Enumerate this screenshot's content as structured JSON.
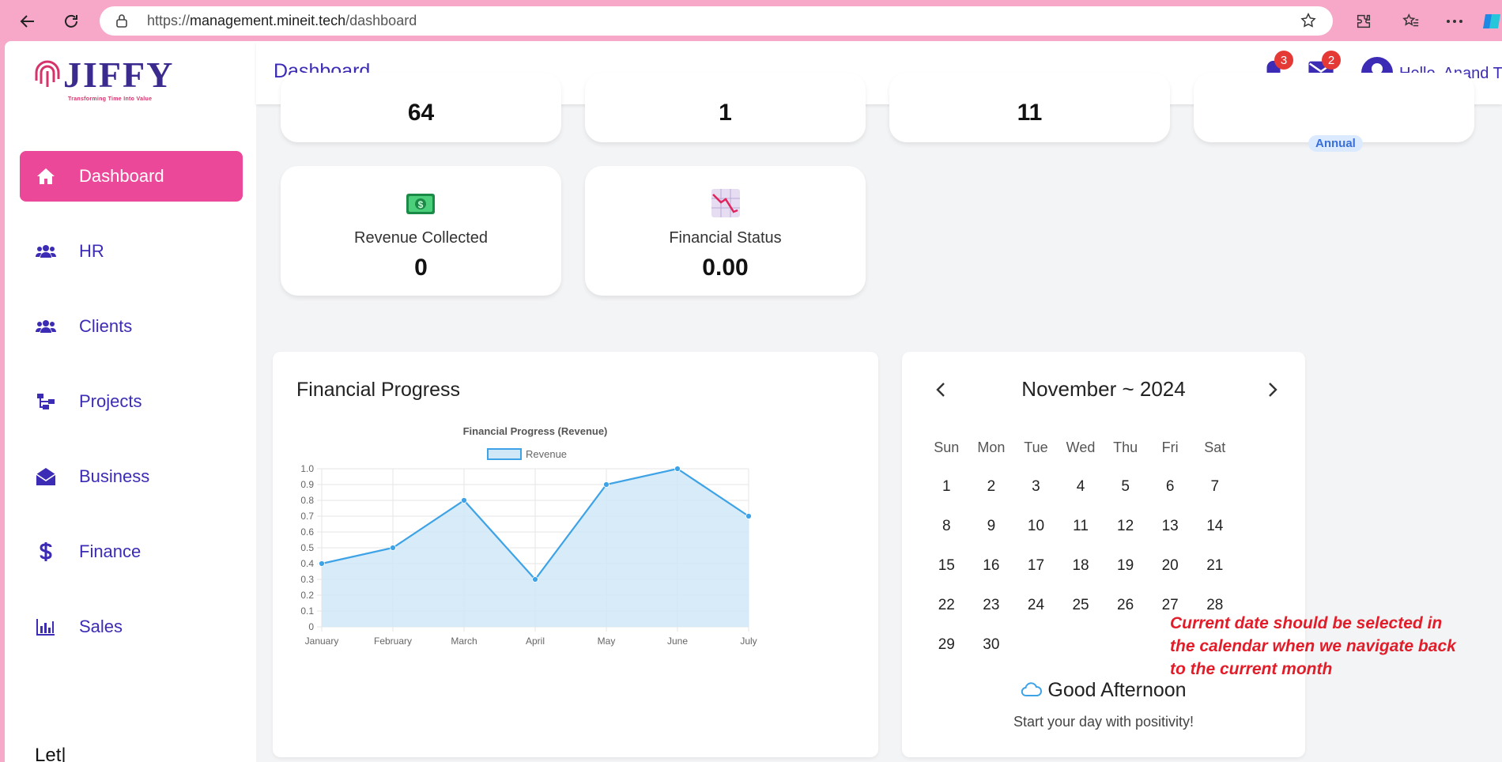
{
  "browser": {
    "url_prefix": "https://",
    "url_host": "management.mineit.tech",
    "url_path": "/dashboard"
  },
  "sidebar": {
    "logo_text": "JIFFY",
    "logo_tagline": "Transforming Time Into Value",
    "items": [
      {
        "label": "Dashboard",
        "icon": "home-icon",
        "active": true
      },
      {
        "label": "HR",
        "icon": "users-icon"
      },
      {
        "label": "Clients",
        "icon": "users-icon"
      },
      {
        "label": "Projects",
        "icon": "sitemap-icon"
      },
      {
        "label": "Business",
        "icon": "envelope-open-icon"
      },
      {
        "label": "Finance",
        "icon": "dollar-icon"
      },
      {
        "label": "Sales",
        "icon": "bar-chart-icon"
      }
    ],
    "footer_text": "Let|"
  },
  "header": {
    "title": "Dashboard",
    "notifications_count": "3",
    "messages_count": "2",
    "greeting": "Hello, Anand T"
  },
  "stats_top": [
    {
      "value": "64"
    },
    {
      "value": "1"
    },
    {
      "value": "11"
    },
    {
      "badge": "Annual"
    }
  ],
  "stats": [
    {
      "label": "Revenue Collected",
      "value": "0",
      "icon": "money-icon"
    },
    {
      "label": "Financial Status",
      "value": "0.00",
      "icon": "chart-decreasing-icon"
    }
  ],
  "financial_panel": {
    "title": "Financial Progress"
  },
  "chart_data": {
    "type": "area",
    "title": "Financial Progress (Revenue)",
    "categories": [
      "January",
      "February",
      "March",
      "April",
      "May",
      "June",
      "July"
    ],
    "series": [
      {
        "name": "Revenue",
        "values": [
          0.4,
          0.5,
          0.8,
          0.3,
          0.9,
          1.0,
          0.7
        ]
      }
    ],
    "yticks": [
      "0",
      "0.1",
      "0.2",
      "0.3",
      "0.4",
      "0.5",
      "0.6",
      "0.7",
      "0.8",
      "0.9",
      "1.0"
    ],
    "ylim": [
      0,
      1.0
    ],
    "grid": true,
    "legend": "top",
    "colors": {
      "line": "#3ea3e6",
      "fill": "#d0e7f7"
    }
  },
  "calendar": {
    "month_label": "November ~ 2024",
    "days_of_week": [
      "Sun",
      "Mon",
      "Tue",
      "Wed",
      "Thu",
      "Fri",
      "Sat"
    ],
    "weeks": [
      [
        "1",
        "2",
        "3",
        "4",
        "5",
        "6",
        "7"
      ],
      [
        "8",
        "9",
        "10",
        "11",
        "12",
        "13",
        "14"
      ],
      [
        "15",
        "16",
        "17",
        "18",
        "19",
        "20",
        "21"
      ],
      [
        "22",
        "23",
        "24",
        "25",
        "26",
        "27",
        "28"
      ],
      [
        "29",
        "30",
        "",
        "",
        "",
        "",
        ""
      ]
    ],
    "greeting": "Good Afternoon",
    "greeting_sub": "Start your day with positivity!"
  },
  "annotation": {
    "lines": [
      "Current date should be selected in",
      "the calendar when we navigate back",
      "to the current month"
    ]
  },
  "colors": {
    "accent": "#ec4899",
    "primary": "#3b2bb5",
    "annotation": "#e11d2a"
  }
}
